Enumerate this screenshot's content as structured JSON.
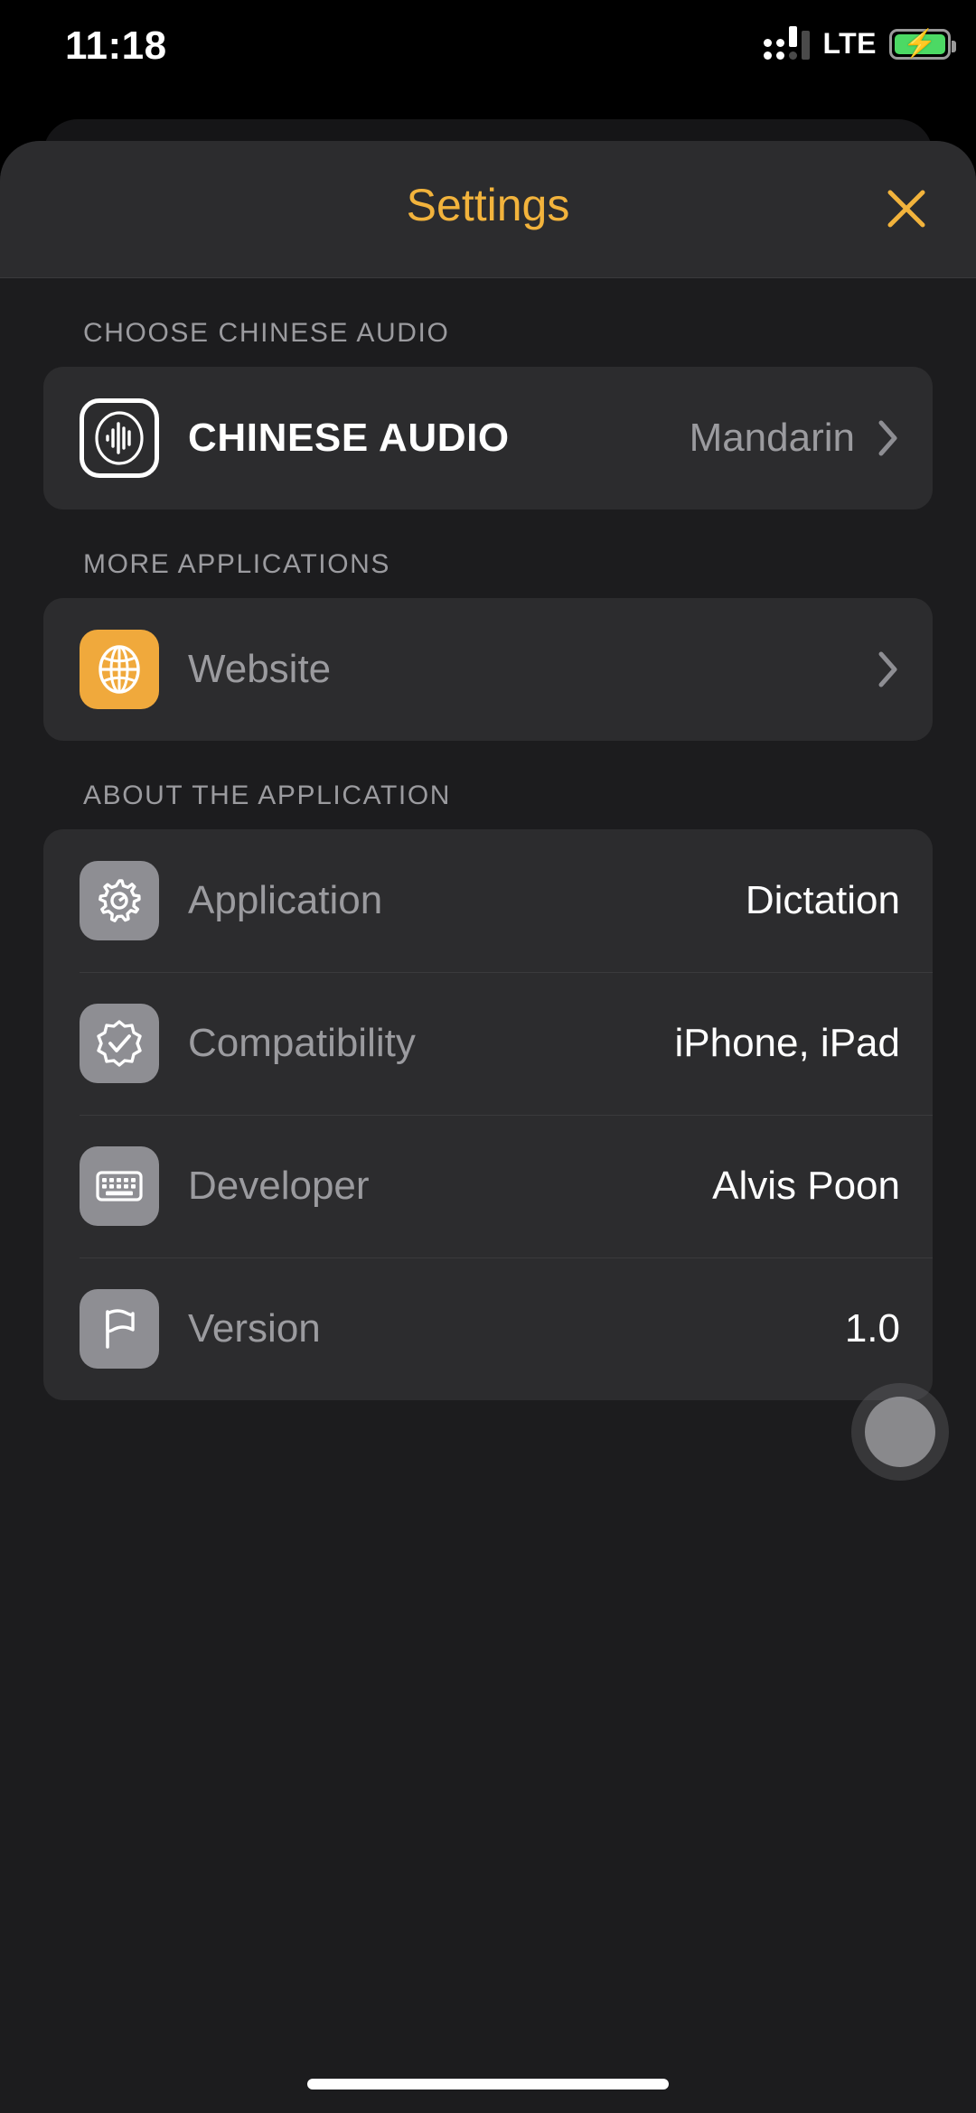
{
  "status_bar": {
    "time": "11:18",
    "network": "LTE",
    "signal_icon": "signal-dots-icon",
    "battery_icon": "battery-charging-icon",
    "battery_color": "#4cd964"
  },
  "header": {
    "title": "Settings",
    "accent_color": "#f2b33c",
    "close_icon": "close-x-icon"
  },
  "sections": [
    {
      "header": "CHOOSE CHINESE AUDIO",
      "rows": [
        {
          "icon": "audio-waveform-circle-icon",
          "label": "CHINESE AUDIO",
          "value": "Mandarin",
          "accessory": "chevron-right-icon"
        }
      ]
    },
    {
      "header": "MORE APPLICATIONS",
      "rows": [
        {
          "icon": "globe-icon",
          "icon_bg": "#f0a93c",
          "label": "Website",
          "value": "",
          "accessory": "chevron-right-icon"
        }
      ]
    },
    {
      "header": "ABOUT THE APPLICATION",
      "rows": [
        {
          "icon": "gear-icon",
          "icon_bg": "#8e8e93",
          "label": "Application",
          "value": "Dictation",
          "accessory": ""
        },
        {
          "icon": "rosette-check-icon",
          "icon_bg": "#8e8e93",
          "label": "Compatibility",
          "value": "iPhone, iPad",
          "accessory": ""
        },
        {
          "icon": "keyboard-icon",
          "icon_bg": "#8e8e93",
          "label": "Developer",
          "value": "Alvis Poon",
          "accessory": ""
        },
        {
          "icon": "flag-icon",
          "icon_bg": "#8e8e93",
          "label": "Version",
          "value": "1.0",
          "accessory": ""
        }
      ]
    }
  ],
  "overlay": {
    "assistive_touch_icon": "assistive-touch-button"
  },
  "colors": {
    "page_background": "#1c1c1e",
    "card_background": "#2c2c2e",
    "accent": "#f2b33c",
    "label_gray": "#9b9b9f",
    "value_white": "#ffffff"
  }
}
